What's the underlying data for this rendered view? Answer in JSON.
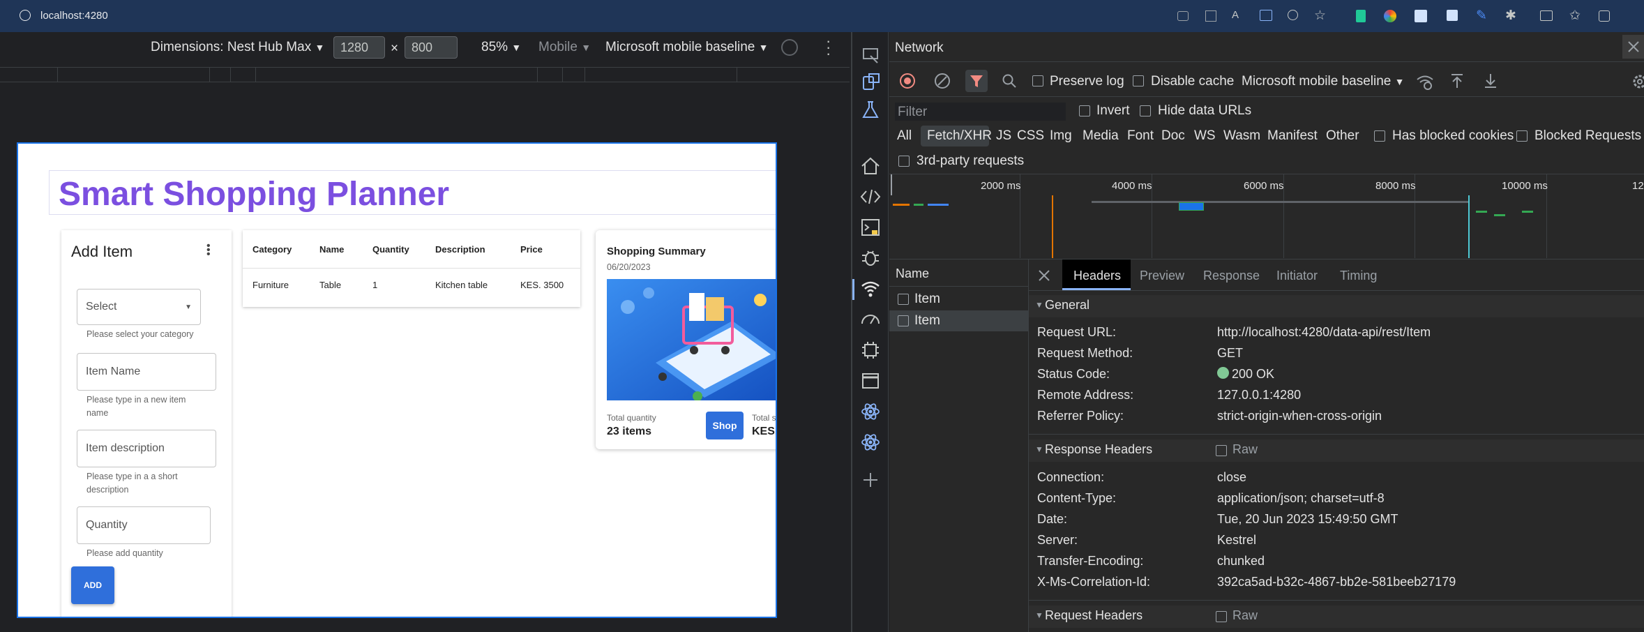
{
  "browser": {
    "url": "localhost:4280"
  },
  "device_toolbar": {
    "dimensions": "Dimensions: Nest Hub Max",
    "width": "1280",
    "times": "×",
    "height": "800",
    "zoom": "85%",
    "mobile": "Mobile",
    "throttle": "Microsoft mobile baseline"
  },
  "app": {
    "title": "Smart Shopping Planner",
    "form": {
      "title": "Add Item",
      "select_placeholder": "Select",
      "select_help": "Please select your category",
      "name_placeholder": "Item Name",
      "name_help_1": "Please type in a new item",
      "name_help_2": "name",
      "desc_placeholder": "Item description",
      "desc_help_1": "Please type in a a short",
      "desc_help_2": "description",
      "qty_placeholder": "Quantity",
      "qty_help": "Please add quantity",
      "add_label": "ADD"
    },
    "table": {
      "headers": [
        "Category",
        "Name",
        "Quantity",
        "Description",
        "Price"
      ],
      "rows": [
        [
          "Furniture",
          "Table",
          "1",
          "Kitchen table",
          "KES. 3500"
        ]
      ]
    },
    "summary": {
      "title": "Shopping Summary",
      "date": "06/20/2023",
      "qty_label": "Total quantity",
      "qty_value": "23 items",
      "shop_label": "Shop",
      "total_label": "Total s",
      "total_value": "KES."
    }
  },
  "network": {
    "title": "Network",
    "preserve_log": "Preserve log",
    "disable_cache": "Disable cache",
    "throttle": "Microsoft mobile baseline",
    "filter_placeholder": "Filter",
    "invert": "Invert",
    "hide_data_urls": "Hide data URLs",
    "types": [
      "All",
      "Fetch/XHR",
      "JS",
      "CSS",
      "Img",
      "Media",
      "Font",
      "Doc",
      "WS",
      "Wasm",
      "Manifest",
      "Other"
    ],
    "has_blocked_cookies": "Has blocked cookies",
    "blocked_requests": "Blocked Requests",
    "third_party": "3rd-party requests",
    "timeline_labels": [
      "2000 ms",
      "4000 ms",
      "6000 ms",
      "8000 ms",
      "10000 ms",
      "12"
    ],
    "name_header": "Name",
    "requests": [
      "Item",
      "Item"
    ],
    "detail_tabs": [
      "Headers",
      "Preview",
      "Response",
      "Initiator",
      "Timing"
    ],
    "general_title": "General",
    "general": [
      {
        "k": "Request URL:",
        "v": "http://localhost:4280/data-api/rest/Item"
      },
      {
        "k": "Request Method:",
        "v": "GET"
      },
      {
        "k": "Status Code:",
        "v": "200 OK"
      },
      {
        "k": "Remote Address:",
        "v": "127.0.0.1:4280"
      },
      {
        "k": "Referrer Policy:",
        "v": "strict-origin-when-cross-origin"
      }
    ],
    "response_headers_title": "Response Headers",
    "raw": "Raw",
    "response_headers": [
      {
        "k": "Connection:",
        "v": "close"
      },
      {
        "k": "Content-Type:",
        "v": "application/json; charset=utf-8"
      },
      {
        "k": "Date:",
        "v": "Tue, 20 Jun 2023 15:49:50 GMT"
      },
      {
        "k": "Server:",
        "v": "Kestrel"
      },
      {
        "k": "Transfer-Encoding:",
        "v": "chunked"
      },
      {
        "k": "X-Ms-Correlation-Id:",
        "v": "392ca5ad-b32c-4867-bb2e-581beeb27179"
      }
    ],
    "request_headers_title": "Request Headers",
    "status_color": "#81c995"
  }
}
